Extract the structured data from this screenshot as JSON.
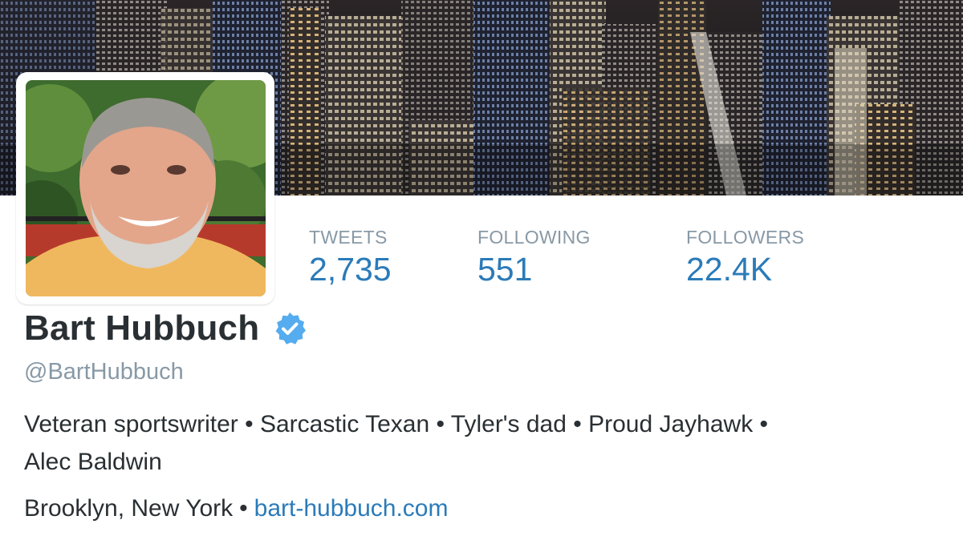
{
  "profile": {
    "name": "Bart Hubbuch",
    "screen_name": "@BartHubbuch",
    "verified": true,
    "bio_line1": "Veteran sportswriter • Sarcastic Texan • Tyler's dad • Proud Jayhawk •",
    "bio_line2": "Alec Baldwin",
    "location": "Brooklyn, New York",
    "separator": "•",
    "website": "bart-hubbuch.com"
  },
  "stats": {
    "tweets": {
      "label": "TWEETS",
      "value": "2,735"
    },
    "following": {
      "label": "FOLLOWING",
      "value": "551"
    },
    "followers": {
      "label": "FOLLOWERS",
      "value": "22.4K"
    }
  },
  "colors": {
    "link": "#2b7bb9",
    "muted": "#8899a6",
    "text": "#292f33",
    "verified": "#55acee"
  },
  "icons": {
    "verified": "verified-badge-icon"
  }
}
